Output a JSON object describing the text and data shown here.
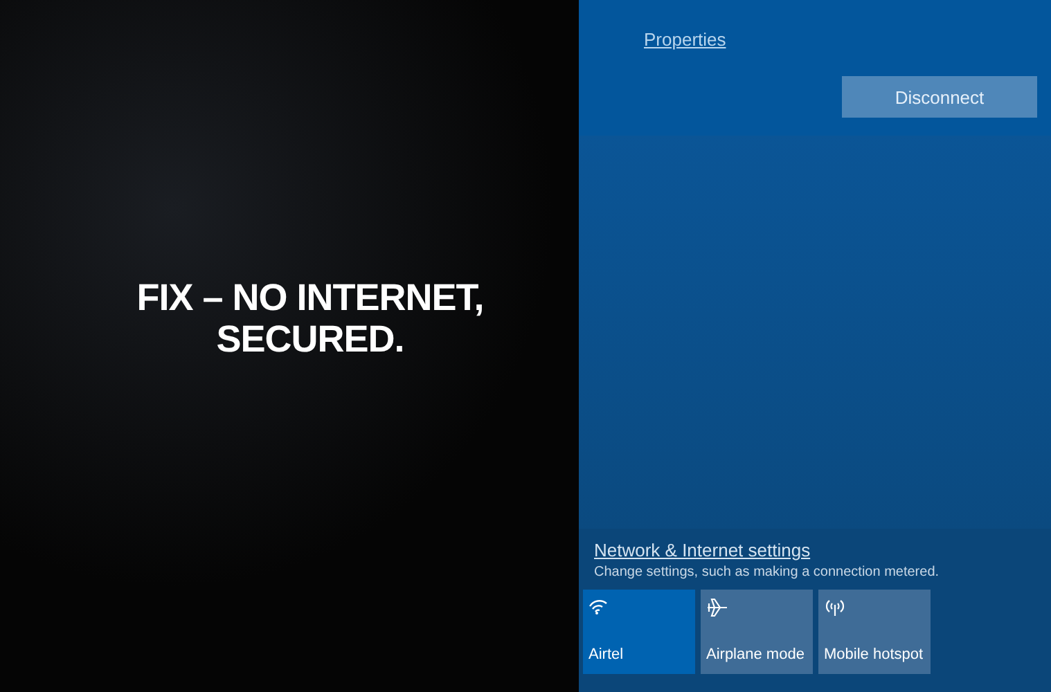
{
  "headline": "FIX – NO INTERNET, SECURED.",
  "network_flyout": {
    "properties_link": "Properties",
    "disconnect_button": "Disconnect",
    "settings_link": "Network & Internet settings",
    "settings_hint": "Change settings, such as making a connection metered.",
    "tiles": [
      {
        "kind": "wifi",
        "label": "Airtel",
        "selected": true
      },
      {
        "kind": "airplane",
        "label": "Airplane mode",
        "selected": false
      },
      {
        "kind": "hotspot",
        "label": "Mobile hotspot",
        "selected": false
      }
    ]
  }
}
